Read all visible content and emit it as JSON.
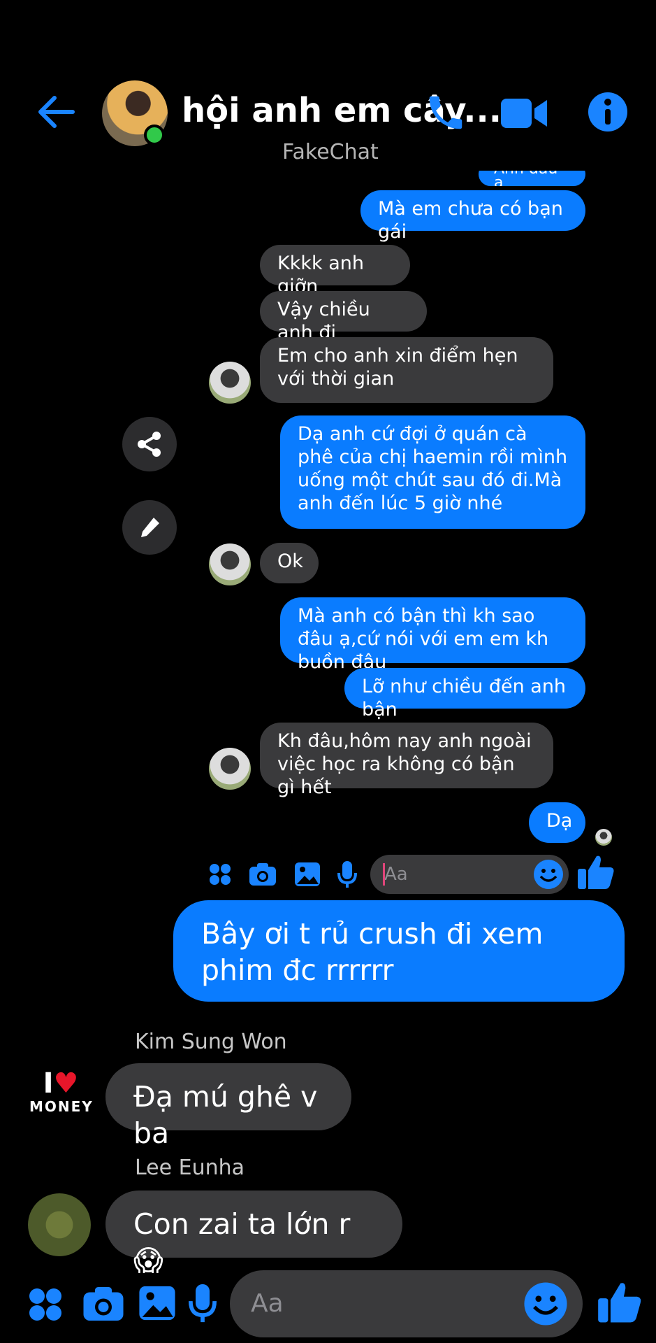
{
  "header": {
    "title": "hội anh em cây...",
    "watermark": "FakeChat"
  },
  "thread": {
    "partial_top": "Anh đâu ạ",
    "messages": [
      {
        "side": "out",
        "text": "Mà em chưa có bạn gái"
      },
      {
        "side": "in",
        "text": "Kkkk anh giỡn"
      },
      {
        "side": "in",
        "text": "Vậy chiều anh đi"
      },
      {
        "side": "in",
        "text": "Em cho anh xin điểm hẹn với thời gian"
      },
      {
        "side": "out",
        "text": "Dạ anh cứ đợi ở quán cà phê của chị haemin rồi mình uống một chút sau đó đi.Mà anh đến lúc 5 giờ nhé"
      },
      {
        "side": "in",
        "text": "Ok"
      },
      {
        "side": "out",
        "text": "Mà anh có bận thì kh sao đâu ạ,cứ nói với em em kh buồn đâu"
      },
      {
        "side": "out",
        "text": "Lỡ như chiều đến anh bận"
      },
      {
        "side": "in",
        "text": "Kh đâu,hôm nay anh ngoài việc học ra không có bận gì hết"
      },
      {
        "side": "out",
        "text": "Dạ"
      }
    ],
    "inner_composer_placeholder": "Aa"
  },
  "group": {
    "my_message": "Bây ơi t rủ crush đi xem phim đc rrrrrr",
    "replies": [
      {
        "sender": "Kim Sung Won",
        "text": "Đạ mú ghê v ba",
        "avatar_text_top": "I",
        "avatar_text_bottom": "MONEY"
      },
      {
        "sender": "Lee Eunha",
        "text": "Con zai ta lớn r😱"
      }
    ]
  },
  "composer": {
    "placeholder": "Aa"
  },
  "colors": {
    "accent": "#0a7cff",
    "incoming": "#3a3a3c",
    "online": "#31c94a"
  }
}
